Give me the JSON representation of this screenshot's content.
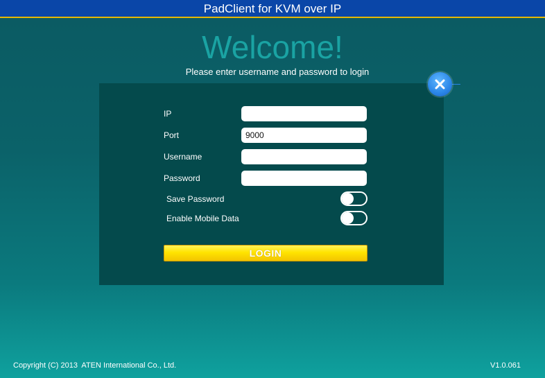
{
  "window": {
    "title": "PadClient for KVM over IP"
  },
  "header": {
    "welcome": "Welcome!",
    "subtitle": "Please enter username and password to login"
  },
  "form": {
    "ip": {
      "label": "IP",
      "value": ""
    },
    "port": {
      "label": "Port",
      "value": "9000"
    },
    "username": {
      "label": "Username",
      "value": ""
    },
    "password": {
      "label": "Password",
      "value": ""
    },
    "save_password": {
      "label": "Save Password",
      "on": false
    },
    "enable_mobile_data": {
      "label": "Enable Mobile Data",
      "on": false
    },
    "login_label": "LOGIN"
  },
  "close_button": {
    "icon": "close-icon"
  },
  "footer": {
    "copyright": "Copyright (C) 2013  ATEN International Co., Ltd.",
    "version": "V1.0.061"
  },
  "colors": {
    "title_bar": "#0a46a8",
    "title_bar_border": "#e6b800",
    "welcome_text": "#1aa3a3",
    "panel": "#044a4c",
    "login_button": "#ffe400",
    "close_button": "#2a86e8"
  }
}
